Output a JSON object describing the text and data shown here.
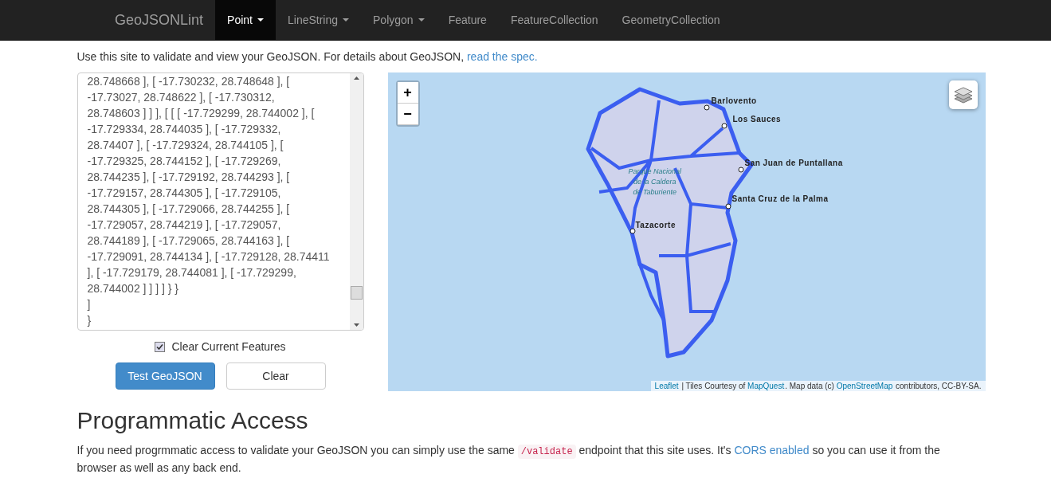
{
  "navbar": {
    "brand": "GeoJSONLint",
    "items": [
      {
        "label": "Point",
        "dropdown": true,
        "selected": true
      },
      {
        "label": "LineString",
        "dropdown": true,
        "selected": false
      },
      {
        "label": "Polygon",
        "dropdown": true,
        "selected": false
      },
      {
        "label": "Feature",
        "dropdown": false,
        "selected": false
      },
      {
        "label": "FeatureCollection",
        "dropdown": false,
        "selected": false
      },
      {
        "label": "GeometryCollection",
        "dropdown": false,
        "selected": false
      }
    ]
  },
  "intro": {
    "text": "Use this site to validate and view your GeoJSON. For details about GeoJSON,",
    "link": "read the spec."
  },
  "editor": {
    "value": "28.748668 ], [ -17.730232, 28.748648 ], [\n-17.73027, 28.748622 ], [ -17.730312,\n28.748603 ] ] ], [ [ [ -17.729299, 28.744002 ], [\n-17.729334, 28.744035 ], [ -17.729332,\n28.74407 ], [ -17.729324, 28.744105 ], [\n-17.729325, 28.744152 ], [ -17.729269,\n28.744235 ], [ -17.729192, 28.744293 ], [\n-17.729157, 28.744305 ], [ -17.729105,\n28.744305 ], [ -17.729066, 28.744255 ], [\n-17.729057, 28.744219 ], [ -17.729057,\n28.744189 ], [ -17.729065, 28.744163 ], [\n-17.729091, 28.744134 ], [ -17.729128, 28.74411\n], [ -17.729179, 28.744081 ], [ -17.729299,\n28.744002 ] ] ] ] } }\n]\n}"
  },
  "clear_features": {
    "label": "Clear Current Features",
    "checked": true
  },
  "buttons": [
    {
      "label": "Test GeoJSON",
      "kind": "primary"
    },
    {
      "label": "Clear",
      "kind": "default"
    }
  ],
  "map": {
    "zoom_in": "+",
    "zoom_out": "−",
    "places": [
      {
        "name": "Barlovento",
        "kind": "town"
      },
      {
        "name": "Los Sauces",
        "kind": "town"
      },
      {
        "name": "San Juan de Puntallana",
        "kind": "town"
      },
      {
        "name": "Santa Cruz de la Palma",
        "kind": "town"
      },
      {
        "name": "Tazacorte",
        "kind": "town"
      },
      {
        "name": "Parque Nacional\nde la Caldera\nde Taburiente",
        "kind": "park"
      }
    ],
    "attribution": [
      {
        "text": "Leaflet",
        "link": true
      },
      {
        "text": " | Tiles Courtesy of ",
        "link": false
      },
      {
        "text": "MapQuest",
        "link": true
      },
      {
        "text": ". Map data (c) ",
        "link": false
      },
      {
        "text": "OpenStreetMap",
        "link": true
      },
      {
        "text": " contributors, CC-BY-SA.",
        "link": false
      }
    ]
  },
  "access": {
    "heading": "Programmatic Access",
    "before": "If you need progrmmatic access to validate your GeoJSON you can simply use the same ",
    "code": "/validate",
    "middle": " endpoint that this site uses. It's ",
    "link": "CORS enabled",
    "after": " so you can use it from the browser as well as any back end."
  }
}
